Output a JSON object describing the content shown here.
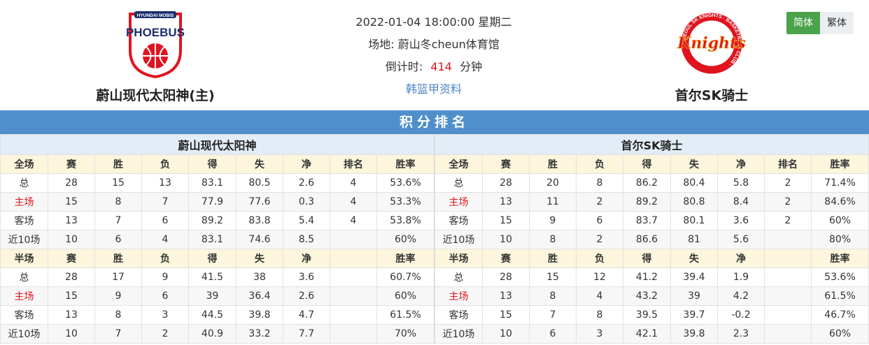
{
  "header": {
    "home_team": {
      "name": "蔚山现代太阳神(主)",
      "logo_top": "HYUNDAI MOBIS",
      "logo_word": "PHOEBUS"
    },
    "away_team": {
      "name": "首尔SK骑士",
      "logo_word": "Knights",
      "logo_ring": "SEOUL SK KNIGHTS · BASKETBALL CLUB ·"
    },
    "datetime": "2022-01-04 18:00:00 星期二",
    "venue_label": "场地:",
    "venue": "蔚山冬cheun体育馆",
    "countdown_label": "倒计时:",
    "countdown_value": "414",
    "countdown_unit": "分钟",
    "league_link": "韩篮甲资料",
    "lang": {
      "simplified": "简体",
      "traditional": "繁体"
    }
  },
  "section_title": "积分排名",
  "colors": {
    "banner": "#4f8fcb",
    "home_red": "#e0141e",
    "header_bg": "#fdf5dc",
    "active_lang": "#4aa34a",
    "link": "#4d86c6"
  },
  "standings": [
    {
      "team": "蔚山现代太阳神",
      "full_header": [
        "全场",
        "赛",
        "胜",
        "负",
        "得",
        "失",
        "净",
        "排名",
        "胜率"
      ],
      "full_rows": [
        [
          "总",
          "28",
          "15",
          "13",
          "83.1",
          "80.5",
          "2.6",
          "4",
          "53.6%"
        ],
        [
          "主场",
          "15",
          "8",
          "7",
          "77.9",
          "77.6",
          "0.3",
          "4",
          "53.3%"
        ],
        [
          "客场",
          "13",
          "7",
          "6",
          "89.2",
          "83.8",
          "5.4",
          "4",
          "53.8%"
        ],
        [
          "近10场",
          "10",
          "6",
          "4",
          "83.1",
          "74.6",
          "8.5",
          "",
          "60%"
        ]
      ],
      "half_header": [
        "半场",
        "赛",
        "胜",
        "负",
        "得",
        "失",
        "净",
        "",
        "胜率"
      ],
      "half_rows": [
        [
          "总",
          "28",
          "17",
          "9",
          "41.5",
          "38",
          "3.6",
          "",
          "60.7%"
        ],
        [
          "主场",
          "15",
          "9",
          "6",
          "39",
          "36.4",
          "2.6",
          "",
          "60%"
        ],
        [
          "客场",
          "13",
          "8",
          "3",
          "44.5",
          "39.8",
          "4.7",
          "",
          "61.5%"
        ],
        [
          "近10场",
          "10",
          "7",
          "2",
          "40.9",
          "33.2",
          "7.7",
          "",
          "70%"
        ]
      ]
    },
    {
      "team": "首尔SK骑士",
      "full_header": [
        "全场",
        "赛",
        "胜",
        "负",
        "得",
        "失",
        "净",
        "排名",
        "胜率"
      ],
      "full_rows": [
        [
          "总",
          "28",
          "20",
          "8",
          "86.2",
          "80.4",
          "5.8",
          "2",
          "71.4%"
        ],
        [
          "主场",
          "13",
          "11",
          "2",
          "89.2",
          "80.8",
          "8.4",
          "2",
          "84.6%"
        ],
        [
          "客场",
          "15",
          "9",
          "6",
          "83.7",
          "80.1",
          "3.6",
          "2",
          "60%"
        ],
        [
          "近10场",
          "10",
          "8",
          "2",
          "86.6",
          "81",
          "5.6",
          "",
          "80%"
        ]
      ],
      "half_header": [
        "半场",
        "赛",
        "胜",
        "负",
        "得",
        "失",
        "净",
        "",
        "胜率"
      ],
      "half_rows": [
        [
          "总",
          "28",
          "15",
          "12",
          "41.2",
          "39.4",
          "1.9",
          "",
          "53.6%"
        ],
        [
          "主场",
          "13",
          "8",
          "4",
          "43.2",
          "39",
          "4.2",
          "",
          "61.5%"
        ],
        [
          "客场",
          "15",
          "7",
          "8",
          "39.5",
          "39.7",
          "-0.2",
          "",
          "46.7%"
        ],
        [
          "近10场",
          "10",
          "6",
          "3",
          "42.1",
          "39.8",
          "2.3",
          "",
          "60%"
        ]
      ]
    }
  ]
}
